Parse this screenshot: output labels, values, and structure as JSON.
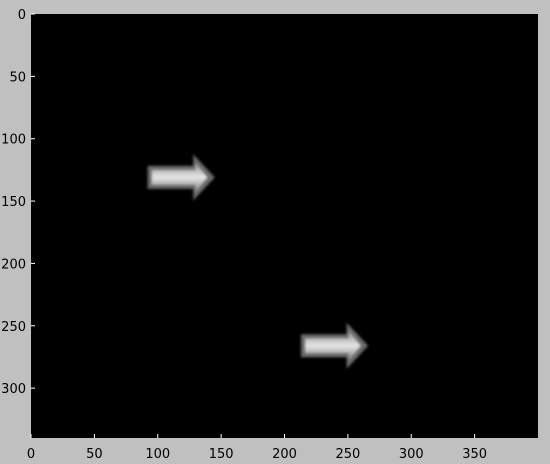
{
  "chart_data": {
    "type": "image",
    "title": "",
    "xlabel": "",
    "ylabel": "",
    "xlim": [
      0,
      400
    ],
    "ylim": [
      340,
      0
    ],
    "x_ticks": [
      0,
      50,
      100,
      150,
      200,
      250,
      300,
      350
    ],
    "y_ticks": [
      0,
      50,
      100,
      150,
      200,
      250,
      300
    ],
    "background_color": "#000000",
    "grid": false,
    "objects": [
      {
        "shape": "arrow",
        "direction": "right",
        "x_start": 92,
        "x_end": 145,
        "y_center": 131,
        "color": "#bdbdbd"
      },
      {
        "shape": "arrow",
        "direction": "right",
        "x_start": 213,
        "x_end": 266,
        "y_center": 266,
        "color": "#bdbdbd"
      }
    ]
  }
}
